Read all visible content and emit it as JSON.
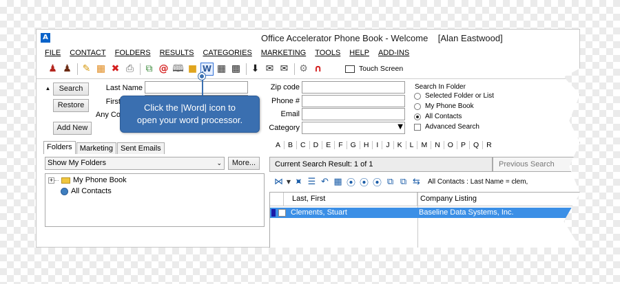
{
  "window": {
    "title": "Office Accelerator Phone Book - Welcome",
    "user": "[Alan Eastwood]",
    "logo": "A"
  },
  "menu": [
    "FILE",
    "CONTACT",
    "FOLDERS",
    "RESULTS",
    "CATEGORIES",
    "MARKETING",
    "TOOLS",
    "HELP",
    "ADD-INS"
  ],
  "toolbar": {
    "icons": [
      "add-contact-icon",
      "group-icon",
      "edit-icon",
      "document-icon",
      "delete-icon",
      "print-icon",
      "copy-icon",
      "email-at-icon",
      "book-icon",
      "folder-icon",
      "word-icon",
      "calendar-icon",
      "calendar2-icon",
      "download-icon",
      "envelope-icon",
      "envelope-outline-icon",
      "gear-icon",
      "magnet-icon"
    ],
    "word_label": "W",
    "touch_screen": "Touch Screen"
  },
  "search": {
    "search_button": "Search",
    "restore_button": "Restore",
    "add_new_button": "Add New",
    "last_name_label": "Last Name",
    "first_label": "First",
    "any_co_label": "Any Co",
    "zip_label": "Zip code",
    "phone_label": "Phone #",
    "email_label": "Email",
    "category_label": "Category",
    "collapse_arrow": "▲"
  },
  "search_in_folder": {
    "title": "Search In Folder",
    "options": [
      "Selected Folder or List",
      "My Phone Book",
      "All Contacts"
    ],
    "selected_index": 2,
    "advanced": "Advanced Search"
  },
  "callout": {
    "line1": "Click the |Word| icon to",
    "line2": "open your word processor."
  },
  "left_panel": {
    "tabs": [
      "Folders",
      "Marketing",
      "Sent Emails"
    ],
    "active_tab": 0,
    "folder_select": "Show My Folders",
    "more_button": "More...",
    "tree": [
      "My Phone Book",
      "All Contacts"
    ],
    "expand_glyph": "+"
  },
  "right_panel": {
    "alphabet": [
      "A",
      "B",
      "C",
      "D",
      "E",
      "F",
      "G",
      "H",
      "I",
      "J",
      "K",
      "L",
      "M",
      "N",
      "O",
      "P",
      "Q",
      "R"
    ],
    "result_text": "Current Search Result: 1 of 1",
    "previous_search": "Previous Search",
    "filter_path": "All Contacts : Last Name = clem,",
    "columns": [
      "Last, First",
      "Company Listing"
    ],
    "rows": [
      {
        "name": "Clements, Stuart",
        "company": "Baseline Data Systems, Inc."
      }
    ]
  }
}
